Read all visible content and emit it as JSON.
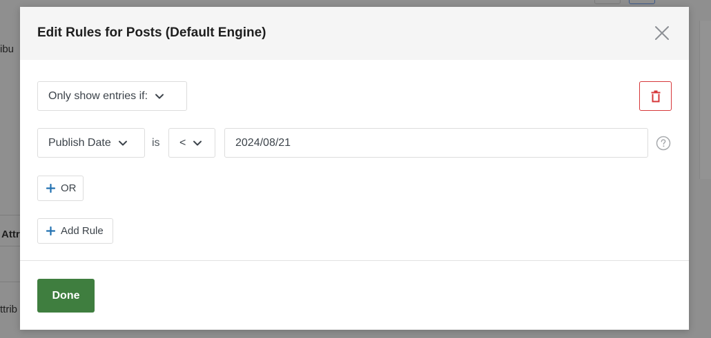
{
  "background": {
    "left_texts": [
      "ibu",
      "Attr",
      "ttrib"
    ]
  },
  "modal": {
    "title": "Edit Rules for Posts (Default Engine)",
    "condition_select": {
      "label": "Only show entries if:"
    },
    "rule": {
      "field_label": "Publish Date",
      "is_text": "is",
      "operator_label": "<",
      "value": "2024/08/21"
    },
    "or_button_label": "OR",
    "add_rule_button_label": "Add Rule",
    "done_button_label": "Done"
  },
  "colors": {
    "accent_blue": "#2271b1",
    "danger_red": "#d63638",
    "done_green": "#3f7e3f"
  },
  "icons": {
    "close": "close-icon",
    "chevron": "chevron-down-icon",
    "trash": "trash-icon",
    "help": "help-icon",
    "plus": "plus-icon"
  }
}
